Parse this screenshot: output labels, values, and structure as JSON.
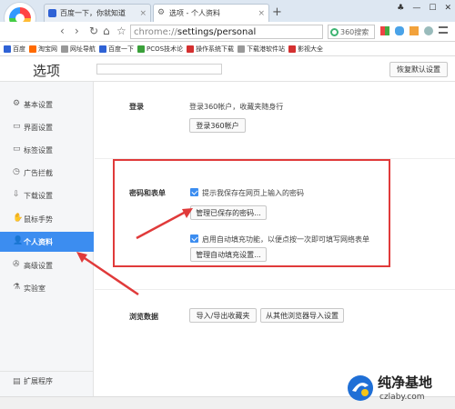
{
  "browser": {
    "tabs": [
      {
        "label": "百度一下，你就知道",
        "close": "×"
      },
      {
        "label": "选项 - 个人资料",
        "close": "×"
      }
    ],
    "new_tab": "+",
    "window_controls": [
      "♣",
      "—",
      "☐",
      "✕"
    ],
    "nav": {
      "back": "‹",
      "forward": "›",
      "reload": "↻",
      "home": "⌂",
      "star": "☆"
    },
    "url_prefix": "chrome://",
    "url_path": "settings/personal",
    "search_text": "360搜索",
    "bookmarks": [
      {
        "label": "百度",
        "color": "#2f62d5"
      },
      {
        "label": "淘宝网",
        "color": "#ff6a00"
      },
      {
        "label": "网址导航",
        "color": "#888888"
      },
      {
        "label": "百度一下",
        "color": "#2f62d5"
      },
      {
        "label": "PCOS技术论",
        "color": "#3aa03a"
      },
      {
        "label": "操作系统下载",
        "color": "#d43030"
      },
      {
        "label": "下载港软件站",
        "color": "#888888"
      },
      {
        "label": "影视大全",
        "color": "#d43030"
      }
    ]
  },
  "settings": {
    "title": "选项",
    "restore_default": "恢复默认设置",
    "sidebar": [
      {
        "label": "基本设置",
        "icon": "⚙"
      },
      {
        "label": "界面设置",
        "icon": "▭"
      },
      {
        "label": "标签设置",
        "icon": "▭"
      },
      {
        "label": "广告拦截",
        "icon": "◷"
      },
      {
        "label": "下载设置",
        "icon": "⇩"
      },
      {
        "label": "鼠标手势",
        "icon": "✋"
      },
      {
        "label": "个人资料",
        "icon": "👤",
        "active": true
      },
      {
        "label": "高级设置",
        "icon": "✇"
      },
      {
        "label": "实验室",
        "icon": "⚗"
      }
    ],
    "extensions": {
      "label": "扩展程序",
      "icon": "▤"
    },
    "login": {
      "label": "登录",
      "desc": "登录360帐户，收藏夹随身行",
      "button": "登录360帐户"
    },
    "password_forms": {
      "label": "密码和表单",
      "save_passwords": "提示我保存在网页上输入的密码",
      "manage_passwords": "管理已保存的密码...",
      "autofill": "启用自动填充功能，以便点按一次即可填写网络表单",
      "manage_autofill": "管理自动填充设置..."
    },
    "browse_data": {
      "label": "浏览数据",
      "import_export": "导入/导出收藏夹",
      "import_other": "从其他浏览器导入设置"
    }
  },
  "annotation": {
    "box_color": "#e03a3a"
  },
  "watermark": {
    "title": "纯净基地",
    "url": "czlaby.com"
  }
}
